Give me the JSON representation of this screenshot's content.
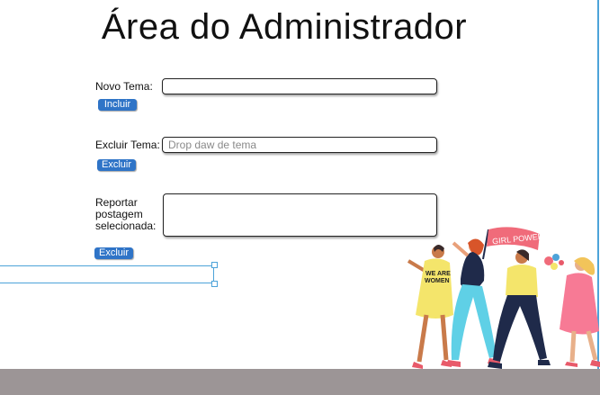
{
  "page": {
    "title": "Área do Administrador"
  },
  "form": {
    "new_theme": {
      "label": "Novo Tema:",
      "value": "",
      "button": "Incluir"
    },
    "delete_theme": {
      "label": "Excluir Tema:",
      "placeholder": "Drop daw de tema",
      "button": "Excluir"
    },
    "report": {
      "label": "Reportar postagem selecionada:",
      "value": "",
      "button": "Excluir"
    }
  },
  "illustration": {
    "banner_text": "GIRL POWER",
    "shirt_text_line1": "WE ARE",
    "shirt_text_line2": "WOMEN"
  },
  "colors": {
    "button": "#2f74c7",
    "selection": "#4da3d9",
    "floor": "#9c9596"
  }
}
